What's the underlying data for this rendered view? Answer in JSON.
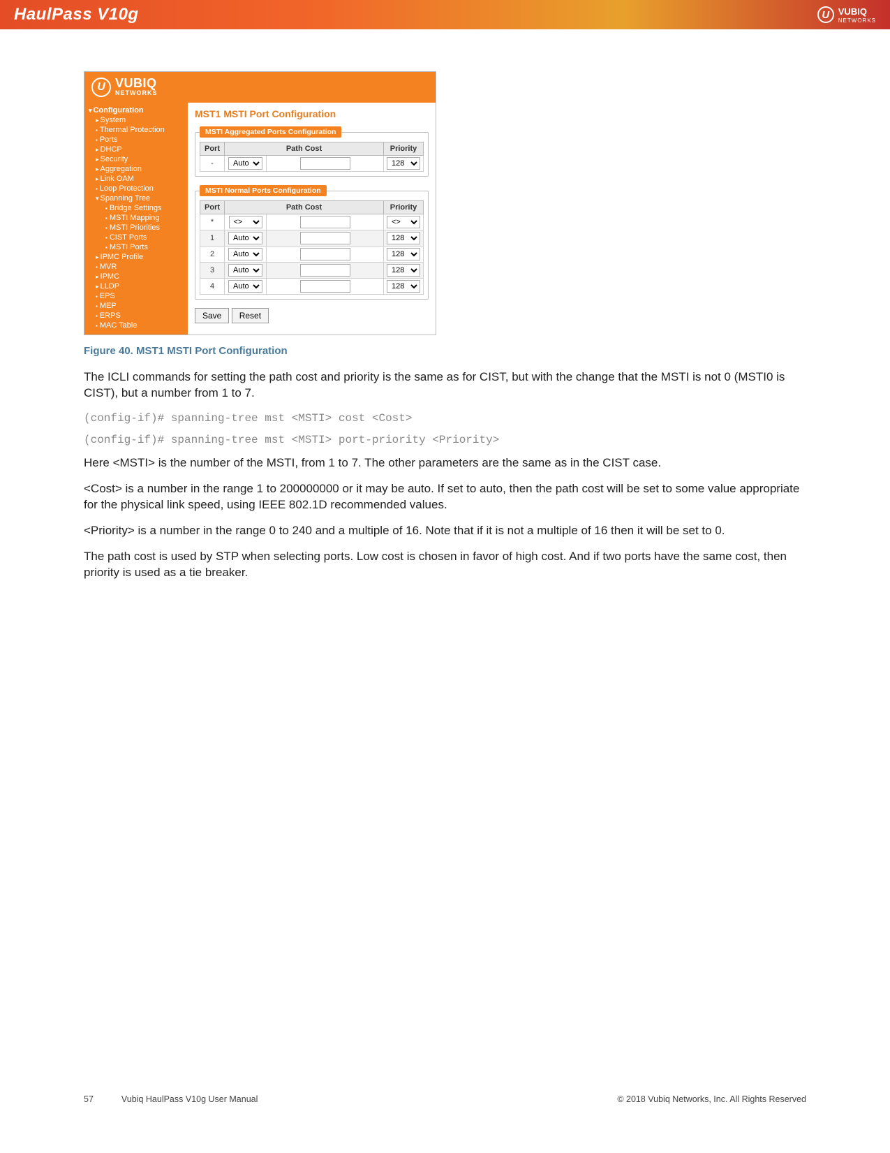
{
  "header": {
    "title": "HaulPass V10g",
    "brand": "VUBIQ",
    "brand_sub": "NETWORKS"
  },
  "shot": {
    "brand": "VUBIQ",
    "brand_sub": "NETWORKS",
    "sidebar": {
      "heading": "Configuration",
      "items": [
        {
          "label": "System",
          "cls": "sub1 caret"
        },
        {
          "label": "Thermal Protection",
          "cls": "sub1 bullet"
        },
        {
          "label": "Ports",
          "cls": "sub1 bullet"
        },
        {
          "label": "DHCP",
          "cls": "sub1 caret"
        },
        {
          "label": "Security",
          "cls": "sub1 caret"
        },
        {
          "label": "Aggregation",
          "cls": "sub1 caret"
        },
        {
          "label": "Link OAM",
          "cls": "sub1 caret"
        },
        {
          "label": "Loop Protection",
          "cls": "sub1 bullet"
        },
        {
          "label": "Spanning Tree",
          "cls": "sub1 careto"
        },
        {
          "label": "Bridge Settings",
          "cls": "sub2 bullet"
        },
        {
          "label": "MSTI Mapping",
          "cls": "sub2 bullet"
        },
        {
          "label": "MSTI Priorities",
          "cls": "sub2 bullet"
        },
        {
          "label": "CIST Ports",
          "cls": "sub2 bullet"
        },
        {
          "label": "MSTI Ports",
          "cls": "sub2 bullet"
        },
        {
          "label": "IPMC Profile",
          "cls": "sub1 caret"
        },
        {
          "label": "MVR",
          "cls": "sub1 bullet"
        },
        {
          "label": "IPMC",
          "cls": "sub1 caret"
        },
        {
          "label": "LLDP",
          "cls": "sub1 caret"
        },
        {
          "label": "EPS",
          "cls": "sub1 bullet"
        },
        {
          "label": "MEP",
          "cls": "sub1 bullet"
        },
        {
          "label": "ERPS",
          "cls": "sub1 bullet"
        },
        {
          "label": "MAC Table",
          "cls": "sub1 bullet"
        }
      ]
    },
    "pane_title": "MST1 MSTI Port Configuration",
    "group1_legend": "MSTI Aggregated Ports Configuration",
    "group2_legend": "MSTI Normal Ports Configuration",
    "cols": {
      "port": "Port",
      "pathcost": "Path Cost",
      "priority": "Priority"
    },
    "agg_rows": [
      {
        "port": "-",
        "cost": "Auto",
        "prio": "128"
      }
    ],
    "normal_rows": [
      {
        "port": "*",
        "cost": "<>",
        "prio": "<>"
      },
      {
        "port": "1",
        "cost": "Auto",
        "prio": "128"
      },
      {
        "port": "2",
        "cost": "Auto",
        "prio": "128"
      },
      {
        "port": "3",
        "cost": "Auto",
        "prio": "128"
      },
      {
        "port": "4",
        "cost": "Auto",
        "prio": "128"
      }
    ],
    "buttons": {
      "save": "Save",
      "reset": "Reset"
    }
  },
  "fig_caption": "Figure 40. MST1 MSTI Port Configuration",
  "p1": "The ICLI commands for setting the path cost and priority is the same as for CIST, but with the change that the MSTI is not 0 (MSTI0 is CIST), but a number from 1 to 7.",
  "code1": "(config-if)# spanning-tree mst <MSTI> cost <Cost>",
  "code2": "(config-if)# spanning-tree mst <MSTI> port-priority <Priority>",
  "p2": "Here <MSTI> is the number of the MSTI, from 1 to 7. The other parameters are the same as in the CIST case.",
  "p3": "<Cost> is a number in the range 1 to 200000000 or it may be auto. If set to auto, then the path cost will be set to some value appropriate for the physical link speed, using IEEE 802.1D recommended values.",
  "p4": "<Priority> is a number in the range 0 to 240 and a multiple of 16. Note that if it is not a multiple of 16 then it will be set to 0.",
  "p5": "The path cost is used by STP when selecting ports. Low cost is chosen in favor of high cost. And if two ports have the same cost, then priority is used as a tie breaker.",
  "footer": {
    "page": "57",
    "manual": "Vubiq HaulPass V10g User Manual",
    "copyright": "© 2018 Vubiq Networks, Inc. All Rights Reserved"
  }
}
